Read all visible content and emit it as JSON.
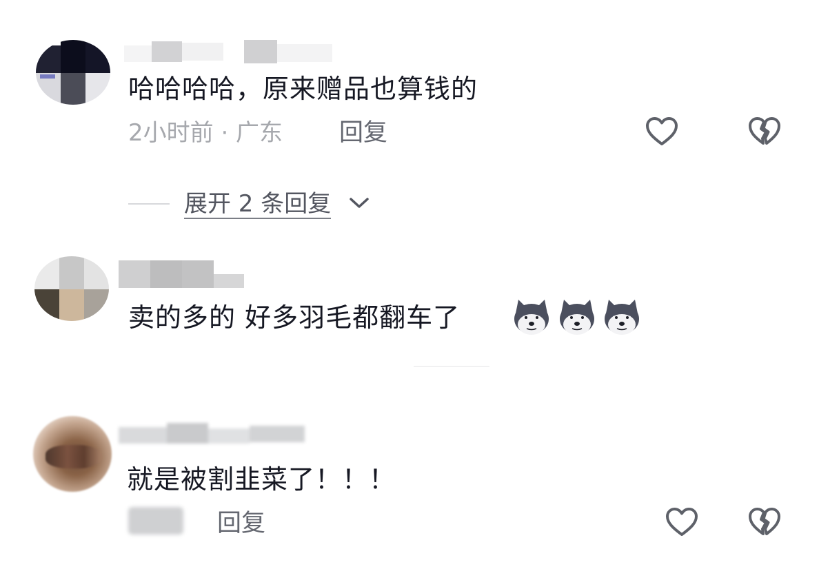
{
  "comments": [
    {
      "text": "哈哈哈哈，原来赠品也算钱的",
      "meta": "2小时前 · 广东",
      "reply_label": "回复",
      "expand_label": "展开 2 条回复"
    },
    {
      "text": "卖的多的 好多羽毛都翻车了",
      "emojis": [
        "husky-emoji",
        "husky-emoji",
        "husky-emoji"
      ]
    },
    {
      "text": "就是被割韭菜了！！！",
      "reply_label": "回复"
    }
  ],
  "icons": {
    "like": "heart-outline-icon",
    "dislike": "broken-heart-icon",
    "expand": "chevron-down-icon"
  },
  "colors": {
    "text": "#161823",
    "meta": "#a6a8ad",
    "reply": "#646770",
    "icon": "#5e6169"
  }
}
